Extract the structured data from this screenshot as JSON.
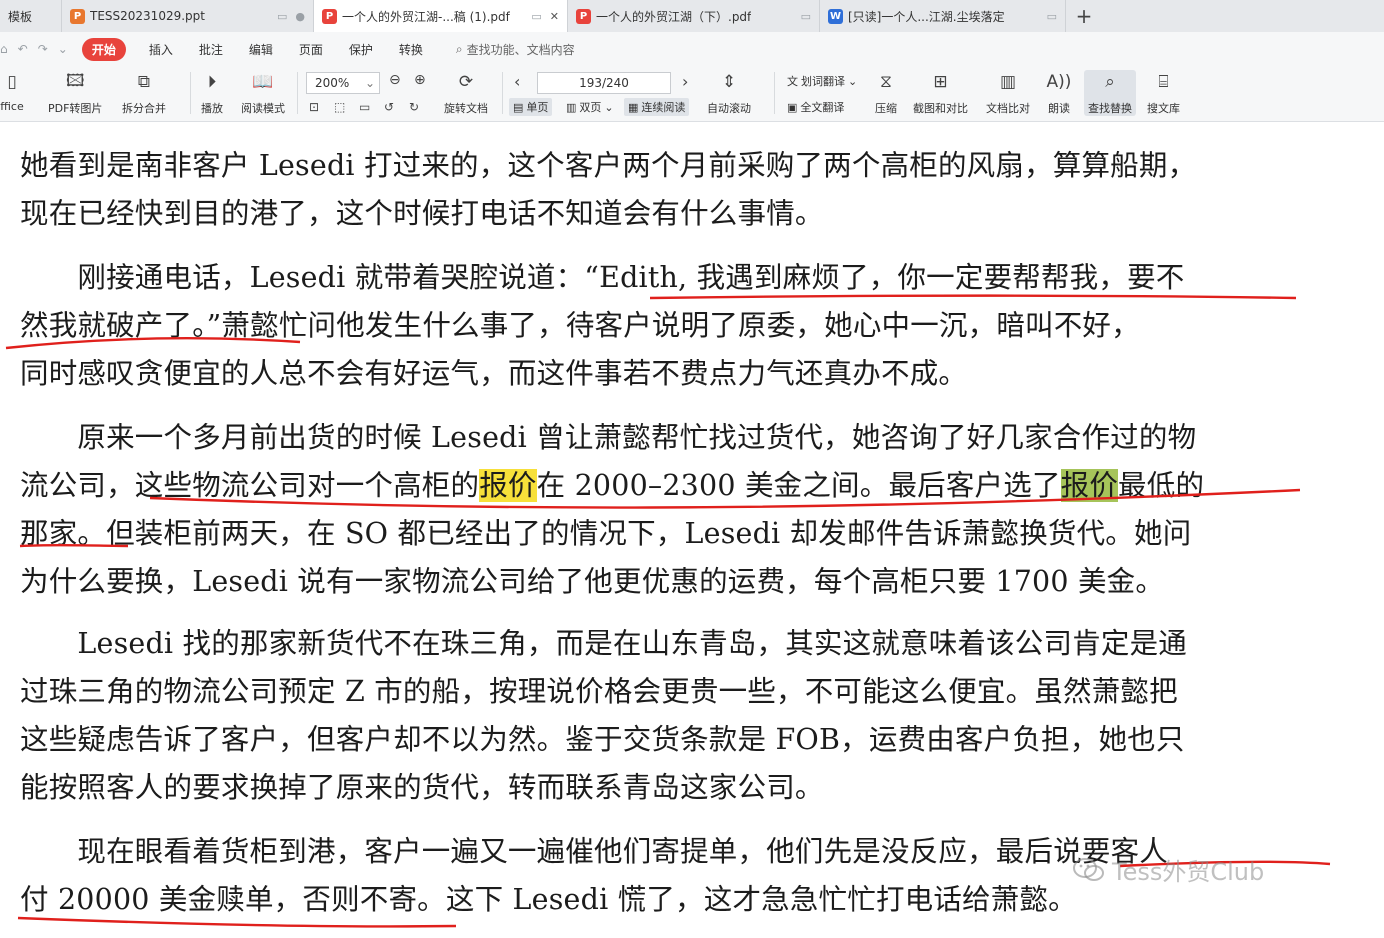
{
  "tabs": [
    {
      "label": "模板",
      "icon": "",
      "color": "#e6e8eb"
    },
    {
      "label": "TESS20231029.ppt",
      "icon": "P",
      "color": "#e8772e"
    },
    {
      "label": "一个人的外贸江湖-...稿 (1).pdf",
      "icon": "P",
      "color": "#e8433c"
    },
    {
      "label": "一个人的外贸江湖（下）.pdf",
      "icon": "P",
      "color": "#e8433c"
    },
    {
      "label": "[只读]一个人...江湖.尘埃落定",
      "icon": "W",
      "color": "#2f6fd8"
    }
  ],
  "tab_add": "+",
  "menu": {
    "items": [
      "开始",
      "插入",
      "批注",
      "编辑",
      "页面",
      "保护",
      "转换"
    ],
    "search_placeholder": "查找功能、文档内容"
  },
  "ribbon": {
    "tools": {
      "office": "ffice",
      "pdf_to_image": "PDF转图片",
      "split_merge": "拆分合并",
      "play": "播放",
      "read_mode": "阅读模式",
      "rotate": "旋转文档",
      "auto_scroll": "自动滚动",
      "word_translate": "划词翻译",
      "full_translate": "全文翻译",
      "compress": "压缩",
      "screenshot_compare": "截图和对比",
      "doc_compare": "文档比对",
      "read_aloud": "朗读",
      "find_replace": "查找替换",
      "search_library": "搜文库"
    },
    "zoom": "200%",
    "page": "193/240",
    "view": {
      "single": "单页",
      "double": "双页",
      "continuous": "连续阅读"
    }
  },
  "document": {
    "lines": [
      {
        "text": "她看到是南非客户 Lesedi 打过来的，这个客户两个月前采购了两个高柜的风扇，算算船期，"
      },
      {
        "text": "现在已经快到目的港了，这个时候打电话不知道会有什么事情。"
      },
      {
        "text": "　　刚接通电话，Lesedi 就带着哭腔说道：“Edith, 我遇到麻烦了，你一定要帮帮我，要不"
      },
      {
        "text": "然我就破产了。”萧懿忙问他发生什么事了，待客户说明了原委，她心中一沉，暗叫不好，"
      },
      {
        "text": "同时感叹贪便宜的人总不会有好运气，而这件事若不费点力气还真办不成。"
      },
      {
        "text": "　　原来一个多月前出货的时候 Lesedi 曾让萧懿帮忙找过货代，她咨询了好几家合作过的物"
      },
      {
        "pre": "流公司，这些物流公司对一个高柜的",
        "hl1": "报价",
        "mid": "在 2000–2300 美金之间。最后客户选了",
        "hl2": "报价",
        "post": "最低的"
      },
      {
        "text": "那家。但装柜前两天，在 SO 都已经出了的情况下，Lesedi 却发邮件告诉萧懿换货代。她问"
      },
      {
        "text": "为什么要换，Lesedi 说有一家物流公司给了他更优惠的运费，每个高柜只要 1700 美金。"
      },
      {
        "text": "　　Lesedi 找的那家新货代不在珠三角，而是在山东青岛，其实这就意味着该公司肯定是通"
      },
      {
        "text": "过珠三角的物流公司预定 Z 市的船，按理说价格会更贵一些，不可能这么便宜。虽然萧懿把"
      },
      {
        "text": "这些疑虑告诉了客户，但客户却不以为然。鉴于交货条款是 FOB，运费由客户负担，她也只"
      },
      {
        "text": "能按照客人的要求换掉了原来的货代，转而联系青岛这家公司。"
      },
      {
        "text": "　　现在眼看着货柜到港，客户一遍又一遍催他们寄提单，他们先是没反应，最后说要客人"
      },
      {
        "text": "付 20000 美金赎单，否则不寄。这下 Lesedi 慌了，这才急急忙忙打电话给萧懿。"
      }
    ]
  },
  "watermark": "Tess外贸Club",
  "colors": {
    "accent": "#e8433c",
    "highlight_yellow": "#f7e03a",
    "highlight_green": "#a6c45a",
    "pen": "#e0201c"
  }
}
